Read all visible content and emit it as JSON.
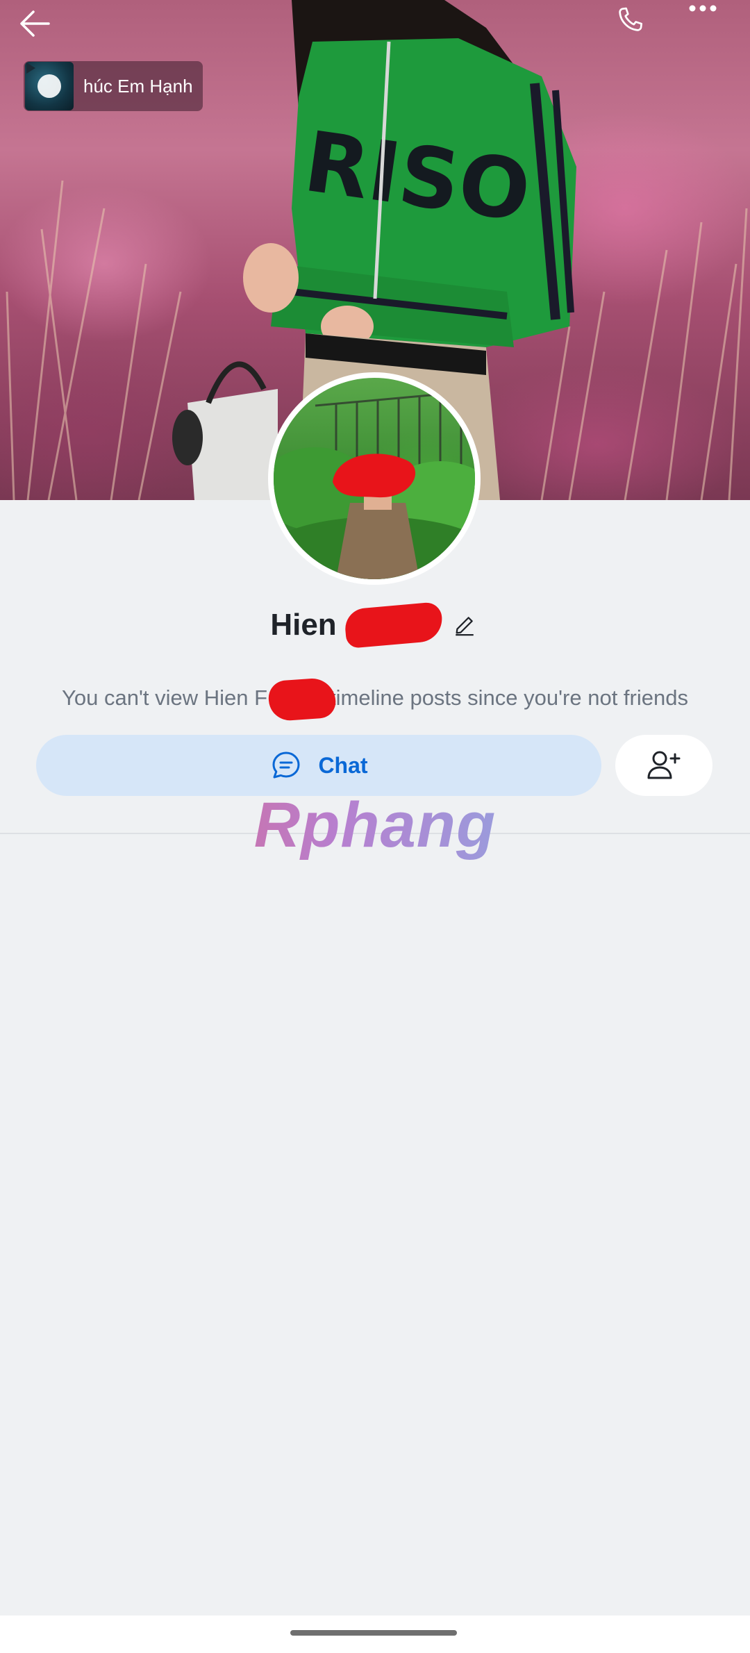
{
  "header": {
    "back_icon": "arrow-left-icon",
    "call_icon": "phone-icon",
    "more_icon": "more-dots-icon"
  },
  "music": {
    "title": "húc Em Hạnh",
    "play_icon": "play-icon"
  },
  "profile": {
    "name": "Hien",
    "edit_icon": "pencil-icon",
    "notice_before": "You can't view Hien F",
    "notice_after": "timeline posts since you're not friends"
  },
  "actions": {
    "chat_label": "Chat",
    "chat_icon": "chat-bubble-icon",
    "add_friend_icon": "add-friend-icon"
  },
  "watermark": {
    "text": "Rphang"
  },
  "colors": {
    "accent": "#0a68d6",
    "chat_bg": "#d6e6f8",
    "page_bg": "#eff1f3",
    "redaction": "#e8141a"
  }
}
